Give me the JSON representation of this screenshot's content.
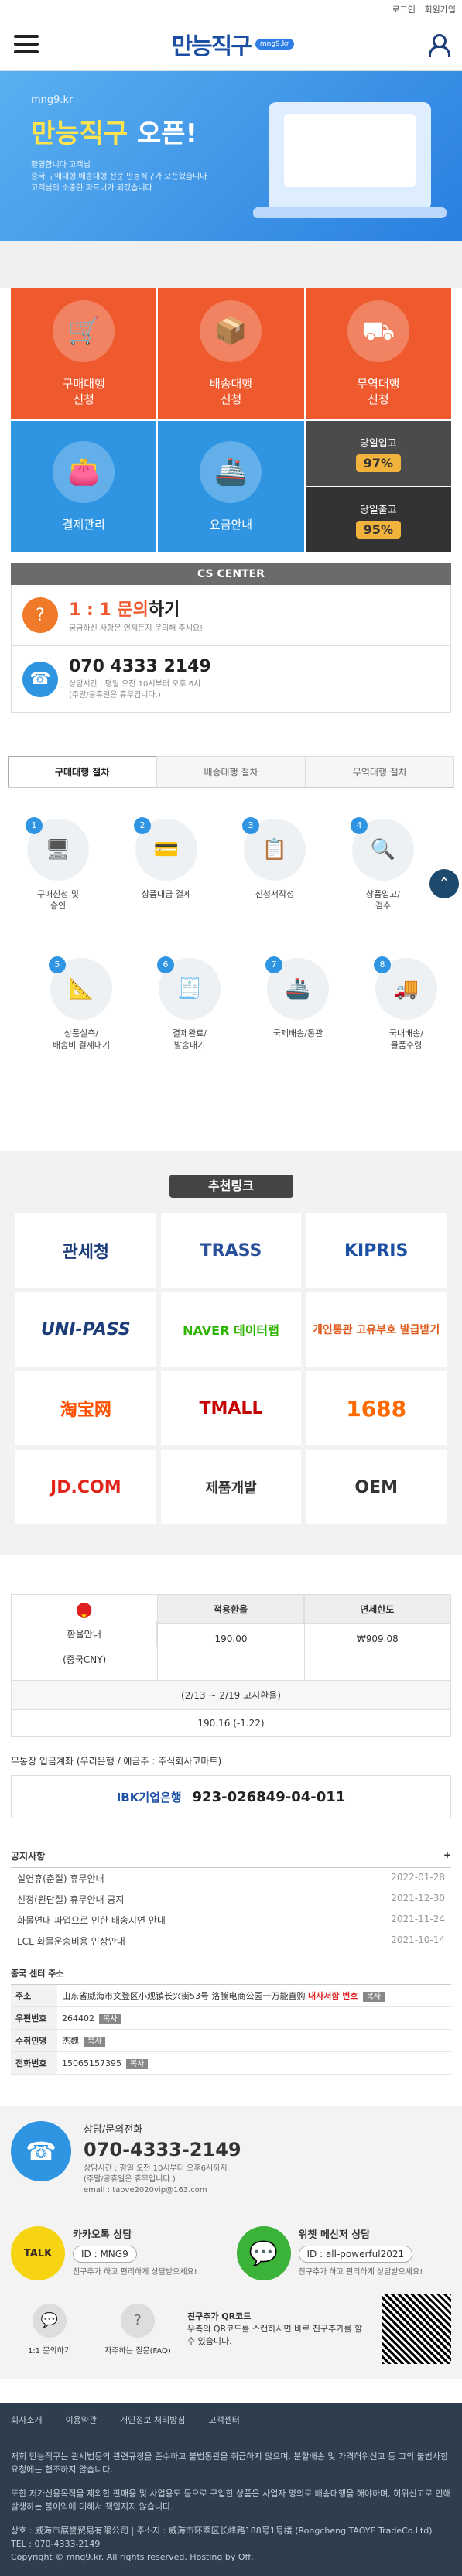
{
  "topbar": {
    "login": "로그인",
    "join": "회원가입"
  },
  "header": {
    "logo": "만능직구",
    "logo_badge": "mng9.kr"
  },
  "banner": {
    "small": "mng9.kr",
    "title_a": "만능직구",
    "title_b": "오픈!",
    "desc_1": "환영합니다 고객님",
    "desc_2": "중국 구매대행 배송대행 전문 만능직구가 오픈했습니다",
    "desc_3": "고객님의 소중한 파트너가 되겠습니다"
  },
  "services": [
    {
      "label": "구매대행",
      "sub": "신청",
      "icon": "cart-icon"
    },
    {
      "label": "배송대행",
      "sub": "신청",
      "icon": "box-icon"
    },
    {
      "label": "무역대행",
      "sub": "신청",
      "icon": "crane-icon"
    },
    {
      "label": "결제관리",
      "sub": "",
      "icon": "wallet-icon"
    },
    {
      "label": "요금안내",
      "sub": "",
      "icon": "ship-icon"
    }
  ],
  "stats": [
    {
      "label": "당일입고",
      "value": "97%"
    },
    {
      "label": "당일출고",
      "value": "95%"
    }
  ],
  "cs": {
    "title": "CS CENTER",
    "inquiry_prefix": "1 : 1 문의",
    "inquiry_suffix": "하기",
    "inquiry_desc": "궁금하신 사항은 언제든지 문의해 주세요!",
    "phone": "070 4333 2149",
    "hours": "상담시간 : 평일 오전 10시부터 오후 6시",
    "holiday": "(주말/공휴일은 휴무입니다.)"
  },
  "tabs": [
    "구매대행 절차",
    "배송대행 절차",
    "무역대행 절차"
  ],
  "steps": [
    {
      "num": "1",
      "label": "구매신청 및\n승인"
    },
    {
      "num": "2",
      "label": "상품대금 결제"
    },
    {
      "num": "3",
      "label": "신청서작성"
    },
    {
      "num": "4",
      "label": "상품입고/\n검수"
    },
    {
      "num": "5",
      "label": "상품실측/\n배송비 결제대기"
    },
    {
      "num": "6",
      "label": "결제완료/\n발송대기"
    },
    {
      "num": "7",
      "label": "국제배송/통관"
    },
    {
      "num": "8",
      "label": "국내배송/\n물품수령"
    }
  ],
  "links": {
    "title": "추천링크",
    "items": [
      "관세청",
      "TRASS",
      "KIPRIS",
      "UNI-PASS",
      "NAVER 데이터랩",
      "개인통관 고유부호 발급받기",
      "淘宝网",
      "TMALL",
      "1688",
      "JD.COM",
      "제품개발",
      "OEM"
    ]
  },
  "rate": {
    "label": "환율안내",
    "currency": "(중국CNY)",
    "col1": "적용환율",
    "col2": "면세한도",
    "val1": "190.00",
    "val2": "₩909.08",
    "date": "(2/13 ~ 2/19 고시환율)",
    "notice": "190.16 (-1.22)"
  },
  "bank": {
    "title": "무통장 입금계좌 (우리은행 / 예금주 : 주식회사코마트)",
    "name": "IBK기업은행",
    "account": "923-026849-04-011"
  },
  "notice": {
    "title": "공지사항",
    "items": [
      {
        "t": "설연휴(춘절) 휴무안내",
        "d": "2022-01-28"
      },
      {
        "t": "신정(원단절) 휴무안내 공지",
        "d": "2021-12-30"
      },
      {
        "t": "화물연대 파업으로 인한 배송지연 안내",
        "d": "2021-11-24"
      },
      {
        "t": "LCL 화물운송비용 인상안내",
        "d": "2021-10-14"
      }
    ]
  },
  "addr": {
    "title": "중국 센터 주소",
    "k1": "주소",
    "v1": "山东省威海市文登区小观镇长兴街53号 洛騰电商公园一万能直购",
    "v1b": "내사서함 번호",
    "k2": "우편번호",
    "v2": "264402",
    "k3": "수취인명",
    "v3": "杰魏",
    "k4": "전화번호",
    "v4": "15065157395",
    "copy": "복사"
  },
  "contact": {
    "label": "상담/문의전화",
    "tel": "070-4333-2149",
    "hours": "상담시간 : 평일 오전 10시부터 오후6시까지",
    "holiday": "(주말/공휴일은 휴무입니다.)",
    "email": "email : taove2020vip@163.com",
    "kakao_title": "카카오톡 상담",
    "kakao_id": "ID : MNG9",
    "kakao_desc": "친구추가 하고 편리하게 상담받으세요!",
    "wechat_title": "위챗 메신저 상담",
    "wechat_id": "ID : all-powerful2021",
    "wechat_desc": "친구추가 하고 편리하게 상담받으세요!",
    "q1": "1:1 문의하기",
    "q2": "자주하는 질문(FAQ)",
    "qr_title": "친구추가 QR코드",
    "qr_desc": "우측의 QR코드를 스캔하시면 바로 친구추가를 할 수 있습니다."
  },
  "footer": {
    "nav": [
      "회사소개",
      "이용약관",
      "개인정보 처리방침",
      "고객센터"
    ],
    "p1": "저희 만능직구는 관세법등의 관련규정을 준수하고 불법통관을 취급하지 않으며, 분할배송 및 가격허위신고 등 고의 불법사항 요청에는 협조하지 않습니다.",
    "p2": "또한 저가신용목적을 제외한 판매용 및 사업용도 등으로 구입한 상품은 사업자 명의로 배송대행을 해야하며, 허위신고로 인해 발생하는 불이익에 대해서 책임지지 않습니다.",
    "company": "상호 : 威海市展誉贸易有限公司 | 주소지 : 威海市环翠区长峰路188号1号楼 (Rongcheng TAOYE TradeCo.Ltd)",
    "tel": "TEL : 070-4333-2149",
    "copyright": "Copyright © mng9.kr. All rights reserved. Hosting by Off."
  }
}
